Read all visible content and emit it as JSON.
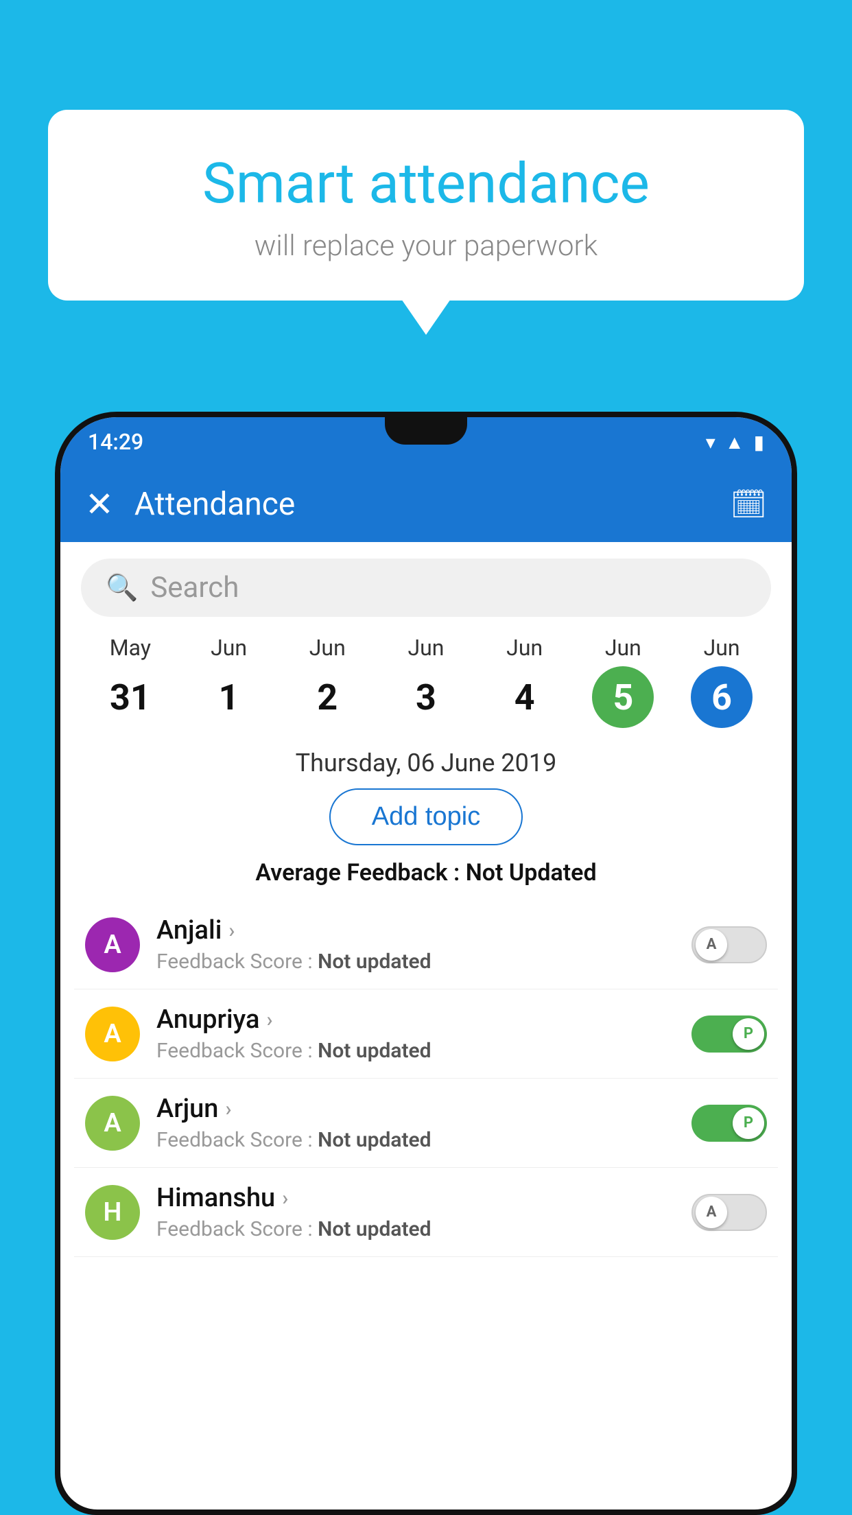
{
  "background_color": "#1cb8e8",
  "bubble": {
    "title": "Smart attendance",
    "subtitle": "will replace your paperwork"
  },
  "status_bar": {
    "time": "14:29",
    "wifi_icon": "▼",
    "signal_icon": "▲",
    "battery_icon": "▮"
  },
  "app_bar": {
    "close_icon": "✕",
    "title": "Attendance",
    "calendar_icon": "📅"
  },
  "search": {
    "placeholder": "Search"
  },
  "dates": [
    {
      "month": "May",
      "day": "31",
      "state": "normal"
    },
    {
      "month": "Jun",
      "day": "1",
      "state": "normal"
    },
    {
      "month": "Jun",
      "day": "2",
      "state": "normal"
    },
    {
      "month": "Jun",
      "day": "3",
      "state": "normal"
    },
    {
      "month": "Jun",
      "day": "4",
      "state": "normal"
    },
    {
      "month": "Jun",
      "day": "5",
      "state": "today"
    },
    {
      "month": "Jun",
      "day": "6",
      "state": "selected"
    }
  ],
  "selected_date_label": "Thursday, 06 June 2019",
  "add_topic_label": "Add topic",
  "avg_feedback_label": "Average Feedback : ",
  "avg_feedback_value": "Not Updated",
  "students": [
    {
      "name": "Anjali",
      "avatar_letter": "A",
      "avatar_color": "#9c27b0",
      "feedback_label": "Feedback Score : ",
      "feedback_value": "Not updated",
      "toggle_state": "off",
      "toggle_label": "A"
    },
    {
      "name": "Anupriya",
      "avatar_letter": "A",
      "avatar_color": "#ffc107",
      "feedback_label": "Feedback Score : ",
      "feedback_value": "Not updated",
      "toggle_state": "on",
      "toggle_label": "P"
    },
    {
      "name": "Arjun",
      "avatar_letter": "A",
      "avatar_color": "#8bc34a",
      "feedback_label": "Feedback Score : ",
      "feedback_value": "Not updated",
      "toggle_state": "on",
      "toggle_label": "P"
    },
    {
      "name": "Himanshu",
      "avatar_letter": "H",
      "avatar_color": "#8bc34a",
      "feedback_label": "Feedback Score : ",
      "feedback_value": "Not updated",
      "toggle_state": "off",
      "toggle_label": "A"
    }
  ]
}
